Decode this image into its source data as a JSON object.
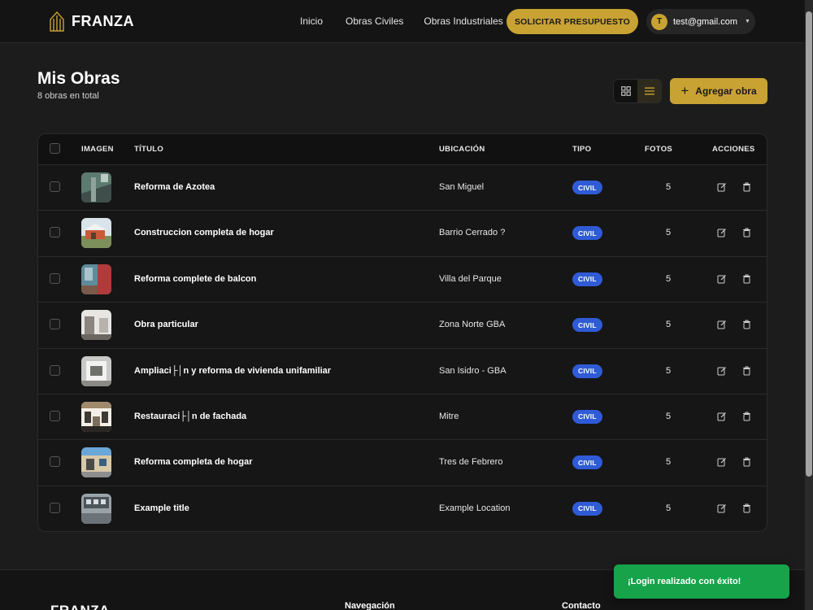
{
  "navbar": {
    "brand": "FRANZA",
    "links": [
      "Inicio",
      "Obras Civiles",
      "Obras Industriales"
    ],
    "cta_label": "SOLICITAR PRESUPUESTO",
    "user_initial": "T",
    "user_email": "test@gmail.com"
  },
  "header": {
    "title": "Mis Obras",
    "subtitle": "8 obras en total",
    "add_label": "Agregar obra"
  },
  "table": {
    "columns": [
      "IMAGEN",
      "TÍTULO",
      "UBICACIÓN",
      "TIPO",
      "FOTOS",
      "ACCIONES"
    ],
    "rows": [
      {
        "title": "Reforma de Azotea",
        "location": "San Miguel",
        "type": "CIVIL",
        "photos": "5"
      },
      {
        "title": "Construccion completa de hogar",
        "location": "Barrio Cerrado ?",
        "type": "CIVIL",
        "photos": "5"
      },
      {
        "title": "Reforma complete de balcon",
        "location": "Villa del Parque",
        "type": "CIVIL",
        "photos": "5"
      },
      {
        "title": "Obra particular",
        "location": "Zona Norte GBA",
        "type": "CIVIL",
        "photos": "5"
      },
      {
        "title": "Ampliaci├│n y reforma de vivienda unifamiliar",
        "location": "San Isidro - GBA",
        "type": "CIVIL",
        "photos": "5"
      },
      {
        "title": "Restauraci├│n de fachada",
        "location": "Mitre",
        "type": "CIVIL",
        "photos": "5"
      },
      {
        "title": "Reforma completa de hogar",
        "location": "Tres de Febrero",
        "type": "CIVIL",
        "photos": "5"
      },
      {
        "title": "Example title",
        "location": "Example Location",
        "type": "CIVIL",
        "photos": "5"
      }
    ]
  },
  "footer": {
    "brand": "FRANZA",
    "nav_heading": "Navegación",
    "contact_heading": "Contacto"
  },
  "toast": {
    "message": "¡Login realizado con éxito!"
  },
  "colors": {
    "accent": "#c9a234",
    "badge": "#2f5bd6",
    "success": "#16a34a",
    "background": "#1c1c1c"
  }
}
